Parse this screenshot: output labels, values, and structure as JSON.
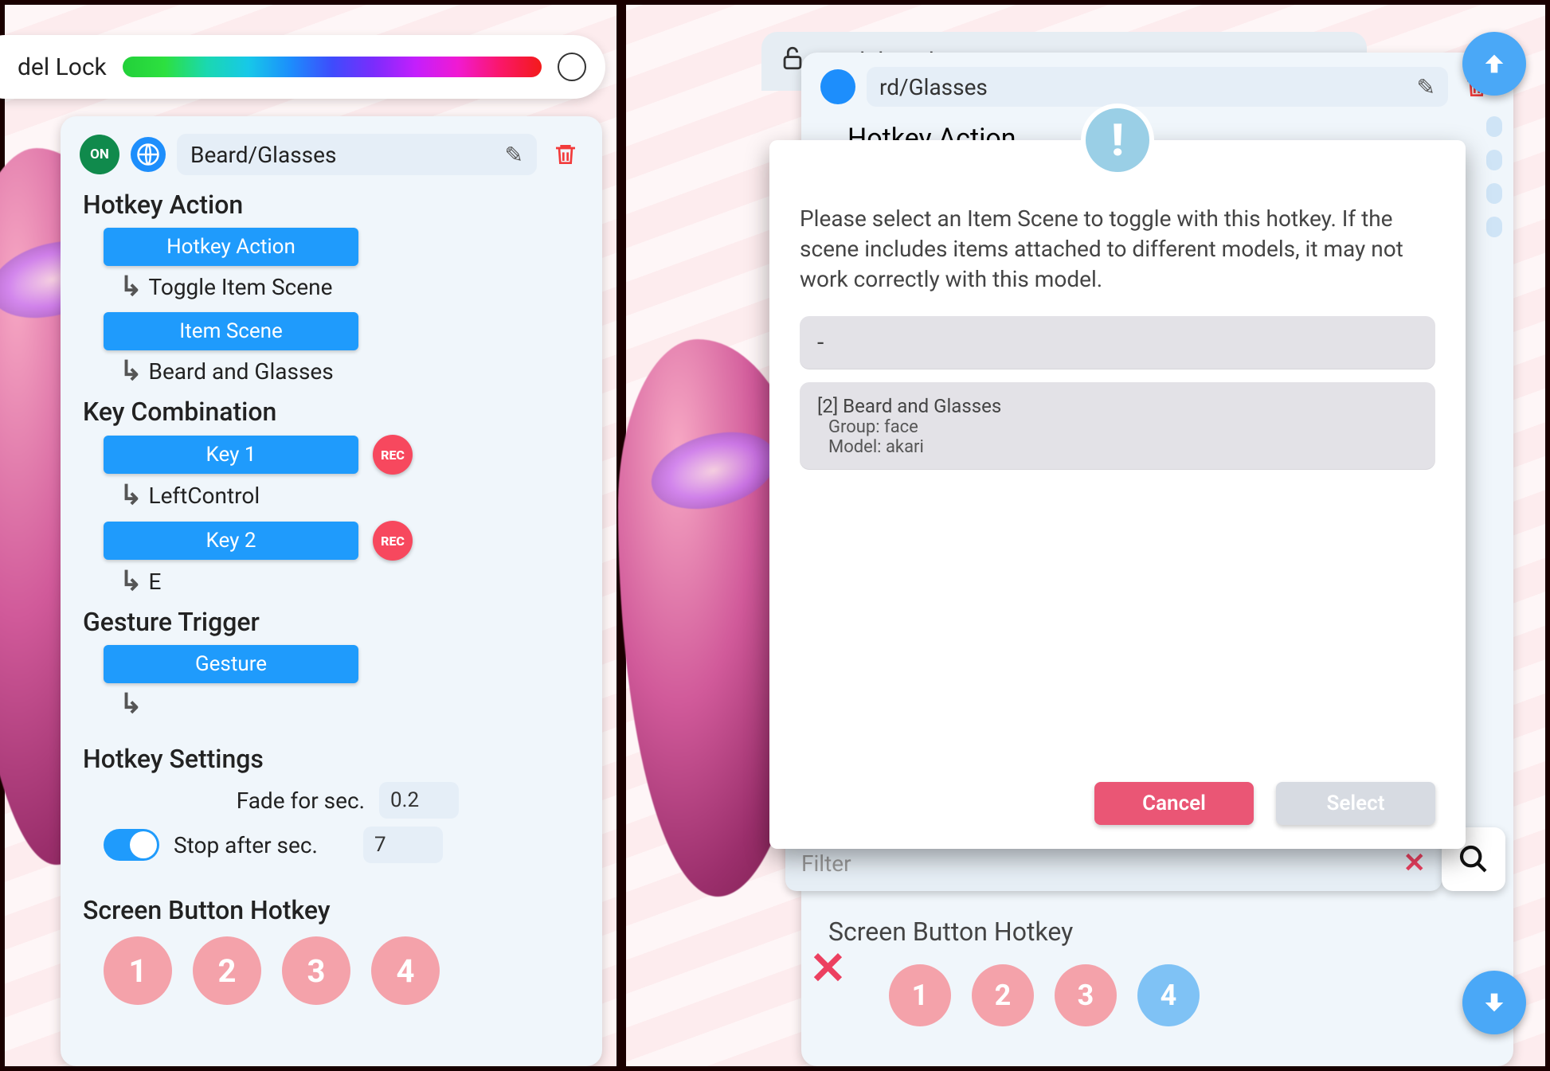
{
  "left": {
    "modelLockLabel": "del Lock",
    "badgeOn": "ON",
    "hotkeyName": "Beard/Glasses",
    "sections": {
      "hotkeyAction": "Hotkey Action",
      "keyCombination": "Key Combination",
      "gestureTrigger": "Gesture Trigger",
      "hotkeySettings": "Hotkey Settings",
      "screenButtonHotkey": "Screen Button Hotkey"
    },
    "buttons": {
      "hotkeyAction": "Hotkey Action",
      "itemScene": "Item Scene",
      "key1": "Key 1",
      "key2": "Key 2",
      "gesture": "Gesture",
      "rec": "REC"
    },
    "values": {
      "toggleItemScene": "Toggle Item Scene",
      "beardAndGlasses": "Beard and Glasses",
      "leftControl": "LeftControl",
      "keyE": "E",
      "gestureValue": ""
    },
    "settings": {
      "fadeLabel": "Fade for sec.",
      "fadeValue": "0.2",
      "stopLabel": "Stop after sec.",
      "stopValue": "7"
    },
    "screenButtons": [
      "1",
      "2",
      "3",
      "4"
    ]
  },
  "right": {
    "modelLockLabel": "Model Lock",
    "hotkeyNameTail": "rd/Glasses",
    "hotkeyAction": "Hotkey Action",
    "screenButtonHotkey": "Screen Button Hotkey",
    "screenButtons": [
      "1",
      "2",
      "3",
      "4"
    ],
    "filterPlaceholder": "Filter"
  },
  "modal": {
    "description": "Please select an Item Scene to toggle with this hotkey. If the scene includes items attached to different models, it may not work correctly with this model.",
    "optionNone": "-",
    "optionTitle": "[2] Beard and Glasses",
    "optionGroup": "Group:  face",
    "optionModel": "Model:  akari",
    "cancel": "Cancel",
    "select": "Select",
    "badge": "!"
  }
}
